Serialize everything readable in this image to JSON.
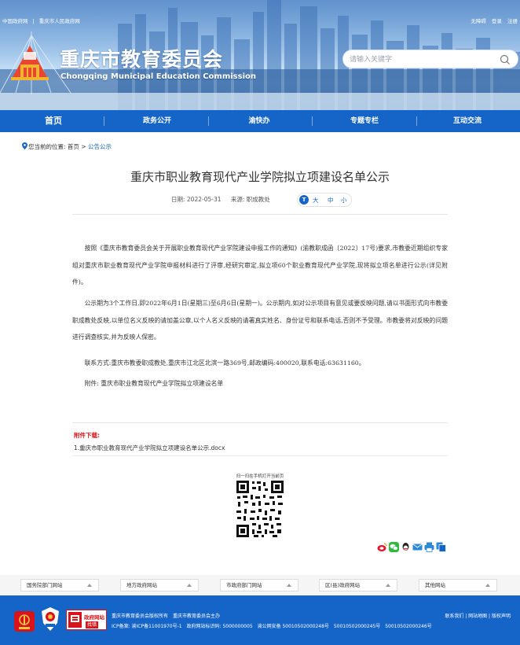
{
  "header": {
    "top_links": [
      "中国政府网",
      "重庆市人民政府网"
    ],
    "top_sep": "|",
    "user_links": [
      "无障碍",
      "登录",
      "注册"
    ],
    "title_cn": "重庆市教育委员会",
    "title_en": "Chongqing Municipal Education Commission",
    "search_placeholder": "请输入关键字"
  },
  "nav": {
    "items": [
      "首页",
      "政务公开",
      "渝快办",
      "专题专栏",
      "互动交流"
    ],
    "color": "#1565c9"
  },
  "breadcrumb": {
    "prefix": "您当前的位置:",
    "home": "首页",
    "sep": ">",
    "current": "公告公示"
  },
  "article": {
    "title": "重庆市职业教育现代产业学院拟立项建设名单公示",
    "date": "日期: 2022-05-31",
    "source": "来源: 职成教处",
    "font_sizes": [
      "大",
      "中",
      "小"
    ],
    "font_icon": "T",
    "paragraphs": [
      "按照《重庆市教育委员会关于开展职业教育现代产业学院建设申报工作的通知》(渝教职成函〔2022〕17号)要求,市教委近期组织专家组对重庆市职业教育现代产业学院申报材料进行了评审,经研究审定,拟立项60个职业教育现代产业学院,现将拟立项名单进行公示(详见附件)。",
      "公示期为3个工作日,即2022年6月1日(星期三)至6月6日(星期一)。公示期内,如对公示项目有意见或要反映问题,请以书面形式向市教委职成教处反映,以单位名义反映的请加盖公章,以个人名义反映的请署真实姓名、身份证号和联系电话,否则不予受理。市教委将对反映的问题进行调查核实,并为反映人保密。",
      "联系方式:重庆市教委职成教处,重庆市江北区北滨一路369号,邮政编码:400020,联系电话:63631160。",
      "附件: 重庆市职业教育现代产业学院拟立项建设名单"
    ],
    "attachment_heading": "附件下载:",
    "attachment_file": "1.重庆市职业教育现代产业学院拟立项建设名单公示.docx",
    "qr_caption": "扫一扫在手机打开当前页"
  },
  "share_icons": [
    "weibo-icon",
    "wechat-icon",
    "qq-icon",
    "mail-icon",
    "print-icon",
    "copy-icon"
  ],
  "site_links": [
    "国务院部门网站",
    "地方政府网站",
    "市政府部门网站",
    "区(县)政府网站",
    "其他网站"
  ],
  "footer": {
    "gov_badge_top": "政府网站",
    "gov_badge_bottom": "找错",
    "sponsor": [
      "重庆市教育委员会版权所有",
      "重庆市教育委员会主办"
    ],
    "icp": "ICP备案: 渝ICP备11001970号-1",
    "site_code": "政府网站标识码: 5000000005",
    "police": [
      "渝公网安备 50010502000248号",
      "50010502000245号",
      "50010502000246号"
    ],
    "links": "联系我们 | 网站地图 | 版权声明"
  }
}
